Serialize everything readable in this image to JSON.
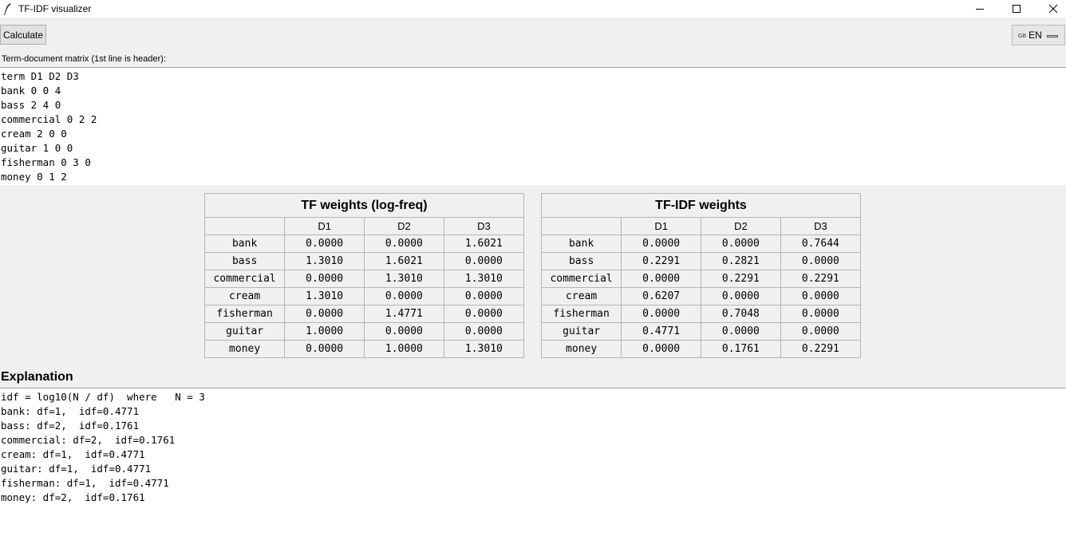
{
  "window": {
    "title": "TF-IDF visualizer",
    "minimize_glyph": "—",
    "close_glyph": "✕"
  },
  "toolbar": {
    "calculate_label": "Calculate",
    "language": {
      "flag": "GB",
      "code": "EN"
    }
  },
  "input": {
    "label": "Term-document matrix (1st line is header):",
    "lines": [
      "term D1 D2 D3",
      "bank 0 0 4",
      "bass 2 4 0",
      "commercial 0 2 2",
      "cream 2 0 0",
      "guitar 1 0 0",
      "fisherman 0 3 0",
      "money 0 1 2"
    ]
  },
  "tf_table": {
    "title": "TF weights (log-freq)",
    "columns": [
      "",
      "D1",
      "D2",
      "D3"
    ],
    "rows": [
      [
        "bank",
        "0.0000",
        "0.0000",
        "1.6021"
      ],
      [
        "bass",
        "1.3010",
        "1.6021",
        "0.0000"
      ],
      [
        "commercial",
        "0.0000",
        "1.3010",
        "1.3010"
      ],
      [
        "cream",
        "1.3010",
        "0.0000",
        "0.0000"
      ],
      [
        "fisherman",
        "0.0000",
        "1.4771",
        "0.0000"
      ],
      [
        "guitar",
        "1.0000",
        "0.0000",
        "0.0000"
      ],
      [
        "money",
        "0.0000",
        "1.0000",
        "1.3010"
      ]
    ]
  },
  "tfidf_table": {
    "title": "TF-IDF weights",
    "columns": [
      "",
      "D1",
      "D2",
      "D3"
    ],
    "rows": [
      [
        "bank",
        "0.0000",
        "0.0000",
        "0.7644"
      ],
      [
        "bass",
        "0.2291",
        "0.2821",
        "0.0000"
      ],
      [
        "commercial",
        "0.0000",
        "0.2291",
        "0.2291"
      ],
      [
        "cream",
        "0.6207",
        "0.0000",
        "0.0000"
      ],
      [
        "fisherman",
        "0.0000",
        "0.7048",
        "0.0000"
      ],
      [
        "guitar",
        "0.4771",
        "0.0000",
        "0.0000"
      ],
      [
        "money",
        "0.0000",
        "0.1761",
        "0.2291"
      ]
    ]
  },
  "explanation": {
    "heading": "Explanation",
    "lines": [
      "idf = log10(N / df)  where   N = 3",
      "bank: df=1,  idf=0.4771",
      "bass: df=2,  idf=0.1761",
      "commercial: df=2,  idf=0.1761",
      "cream: df=1,  idf=0.4771",
      "guitar: df=1,  idf=0.4771",
      "fisherman: df=1,  idf=0.4771",
      "money: df=2,  idf=0.1761"
    ]
  }
}
